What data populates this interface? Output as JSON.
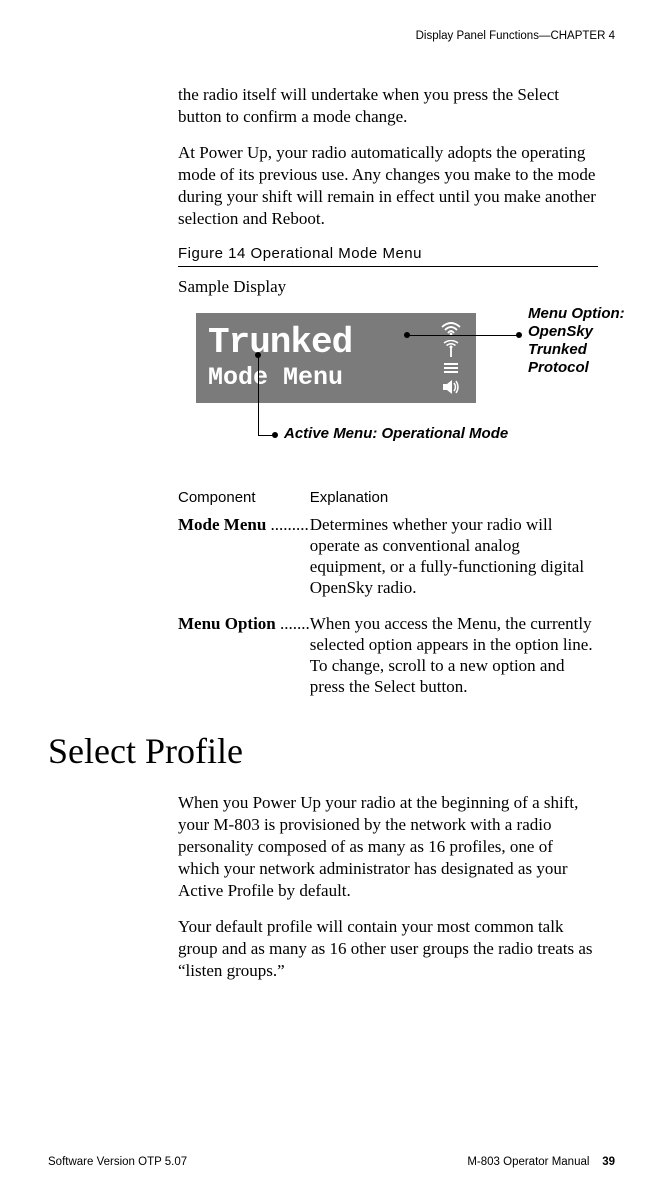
{
  "header": {
    "text": "Display Panel Functions—CHAPTER 4"
  },
  "intro": {
    "p1": "the radio itself will undertake when you press the Select button to confirm a mode change.",
    "p2": "At Power Up, your radio automatically adopts the operating mode of its previous use. Any changes you make to the mode during your shift will remain in effect until you make another selection and Reboot."
  },
  "figure": {
    "title": "Figure 14 Operational Mode Menu",
    "sample_label": "Sample Display",
    "display_line1": "Trunked",
    "display_line2": "Mode Menu",
    "callout1_l1": "Menu Option:",
    "callout1_l2": "OpenSky",
    "callout1_l3": "Trunked",
    "callout1_l4": "Protocol",
    "callout2": "Active Menu: Operational Mode"
  },
  "table": {
    "head_component": "Component",
    "head_explanation": "Explanation",
    "rows": [
      {
        "label": "Mode Menu",
        "dots": " .........",
        "text": "Determines whether your radio will operate as conventional analog equipment, or a fully-functioning digital OpenSky radio."
      },
      {
        "label": "Menu Option",
        "dots": " .......",
        "text": "When you access the Menu, the currently selected option appears in the option line. To change, scroll to a new option and press the Select button."
      }
    ]
  },
  "section": {
    "title": "Select Profile",
    "p1": "When you Power Up your radio at the beginning of a shift, your M-803 is provisioned by the network with a radio personality composed of as many as 16 profiles, one of which your network administrator has designated as your Active Profile by default.",
    "p2": "Your default profile will contain your most common talk group and as many as 16 other user groups the radio treats as “listen groups.”"
  },
  "footer": {
    "left": "Software Version OTP 5.07",
    "right_text": "M-803 Operator Manual",
    "page": "39"
  }
}
